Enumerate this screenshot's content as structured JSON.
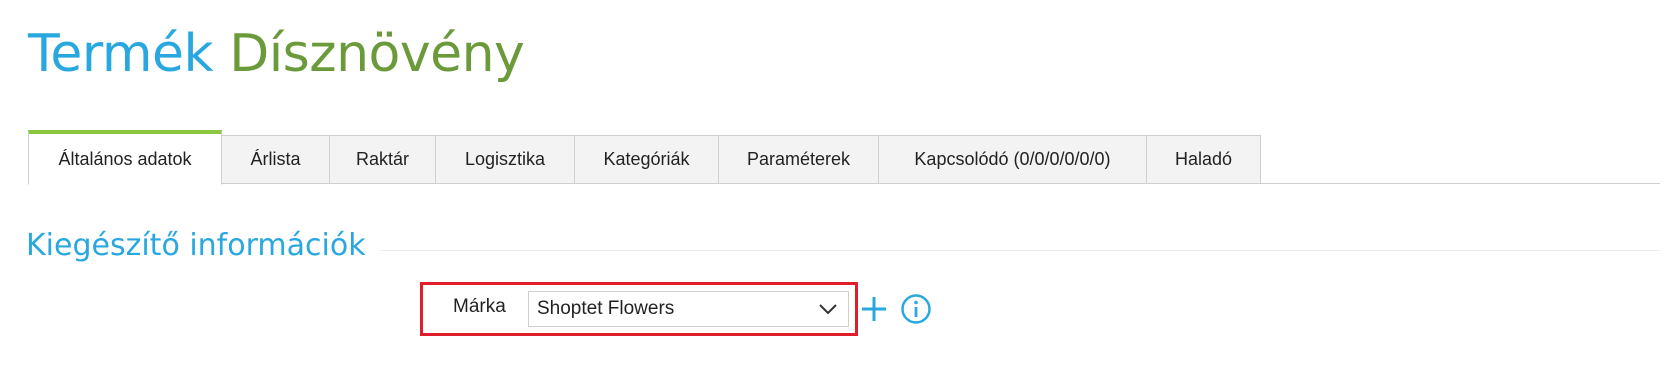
{
  "header": {
    "title_prefix": "Termék",
    "title_product": "Dísznövény"
  },
  "tabs": [
    {
      "label": "Általános adatok",
      "active": true
    },
    {
      "label": "Árlista"
    },
    {
      "label": "Raktár"
    },
    {
      "label": "Logisztika"
    },
    {
      "label": "Kategóriák"
    },
    {
      "label": "Paraméterek"
    },
    {
      "label": "Kapcsolódó (0/0/0/0/0/0)"
    },
    {
      "label": "Haladó"
    }
  ],
  "section": {
    "title": "Kiegészítő információk"
  },
  "brand_field": {
    "label": "Márka",
    "selected": "Shoptet Flowers"
  },
  "icons": {
    "add": "plus-icon",
    "info": "info-icon",
    "dropdown": "chevron-down-icon"
  },
  "colors": {
    "title_blue": "#29a8e0",
    "title_green": "#6b9a3b",
    "active_tab_accent": "#8dc63f",
    "highlight_red": "#e01e2b"
  }
}
